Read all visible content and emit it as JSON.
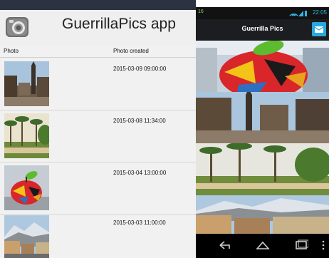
{
  "web": {
    "app_title": "GuerrillaPics app",
    "columns": {
      "photo": "Photo",
      "created": "Photo created"
    },
    "rows": [
      {
        "date": "2015-03-09 09:00:00",
        "thumb": "cathedral-square-photo"
      },
      {
        "date": "2015-03-08 11:34:00",
        "thumb": "palm-park-photo"
      },
      {
        "date": "2015-03-04 13:00:00",
        "thumb": "apple-sculpture-photo"
      },
      {
        "date": "2015-03-03 11:00:00",
        "thumb": "mountain-town-photo"
      }
    ]
  },
  "phone": {
    "status": {
      "badges": "16",
      "time": "22:05"
    },
    "title": "Guerrilla Pics",
    "photos": [
      "apple-sculpture-photo",
      "cathedral-square-photo",
      "palm-park-photo",
      "mountain-town-photo"
    ]
  },
  "colors": {
    "accent": "#29a8e0",
    "clock": "#33b5e5",
    "action_bar": "#1b1d20"
  }
}
